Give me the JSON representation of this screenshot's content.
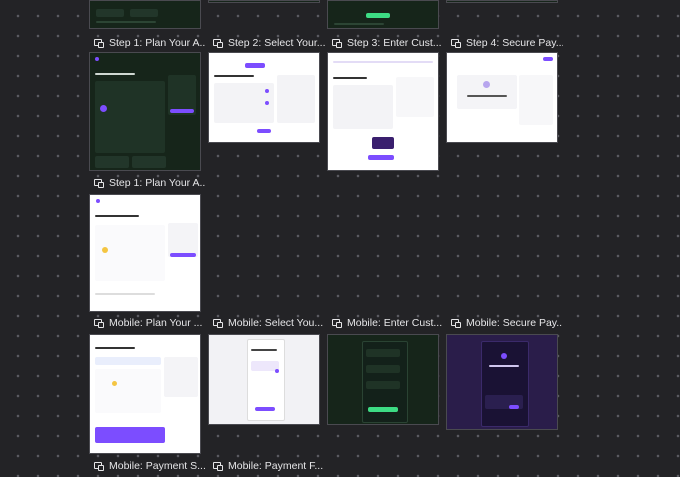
{
  "colors": {
    "canvas": "#232326",
    "accent_purple": "#7c4dff",
    "accent_green": "#3ddc84",
    "dark_frame": "#16251a",
    "light_frame": "#ffffff"
  },
  "icon": "frame-icon",
  "labels": {
    "r0c0": "Step 1: Plan Your A...",
    "r0c1": "Step 2: Select Your...",
    "r0c2": "Step 3: Enter Cust...",
    "r0c3": "Step 4: Secure Pay...",
    "r1c0": "Step 1: Plan Your A...",
    "r2c0": "Mobile: Plan Your ...",
    "r2c1": "Mobile: Select You...",
    "r2c2": "Mobile: Enter Cust...",
    "r2c3": "Mobile: Secure Pay...",
    "r3c0": "Mobile: Payment S...",
    "r3c1": "Mobile: Payment F..."
  }
}
